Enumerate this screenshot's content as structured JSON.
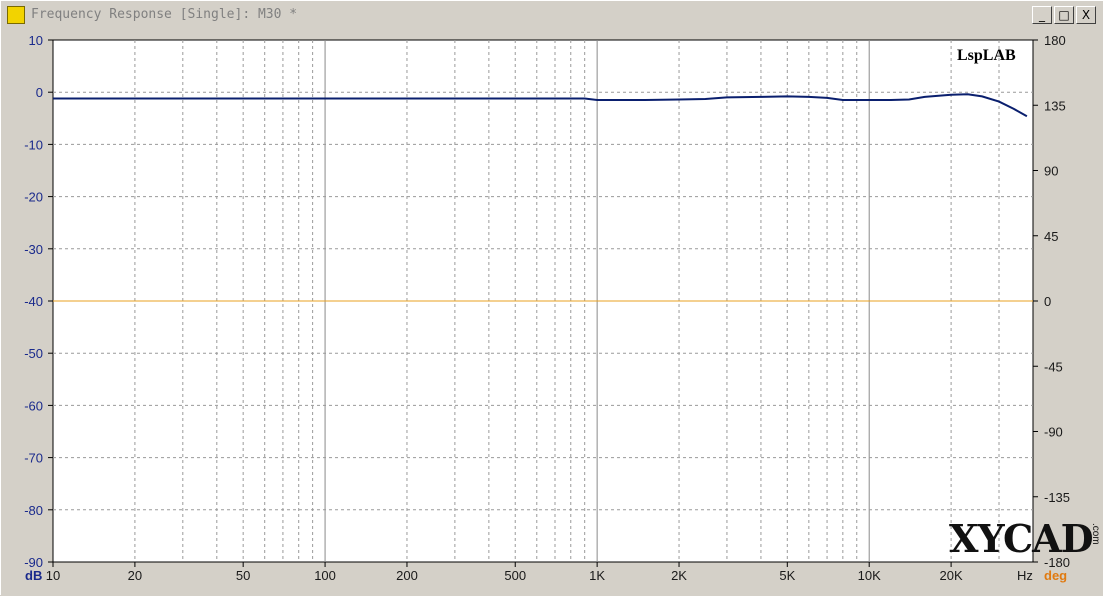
{
  "window": {
    "title": "Frequency Response [Single]: M30 *",
    "buttons": {
      "minimize": "_",
      "maximize": "□",
      "close": "X"
    }
  },
  "brand": "LspLAB",
  "watermark": {
    "text": "XYCAD",
    "suffix": ".com"
  },
  "colors": {
    "background": "#ffffff",
    "magnitude_line": "#0a1f6e",
    "phase_line": "#e8a020",
    "grid": "#9a9a9a",
    "left_axis_text": "#1a2a8c",
    "deg_label": "#e07a10"
  },
  "chart_data": {
    "type": "line",
    "x_scale": "log",
    "xlim": [
      10,
      40000
    ],
    "x_unit": "Hz",
    "x_ticks": [
      {
        "value": 10,
        "label": "10"
      },
      {
        "value": 20,
        "label": "20"
      },
      {
        "value": 50,
        "label": "50"
      },
      {
        "value": 100,
        "label": "100"
      },
      {
        "value": 200,
        "label": "200"
      },
      {
        "value": 500,
        "label": "500"
      },
      {
        "value": 1000,
        "label": "1K"
      },
      {
        "value": 2000,
        "label": "2K"
      },
      {
        "value": 5000,
        "label": "5K"
      },
      {
        "value": 10000,
        "label": "10K"
      },
      {
        "value": 20000,
        "label": "20K"
      }
    ],
    "y_left": {
      "unit": "dB",
      "ylim": [
        -90,
        10
      ],
      "ticks": [
        10,
        0,
        -10,
        -20,
        -30,
        -40,
        -50,
        -60,
        -70,
        -80,
        -90
      ]
    },
    "y_right": {
      "unit": "deg",
      "ylim": [
        -180,
        180
      ],
      "ticks": [
        180,
        135,
        90,
        45,
        0,
        -45,
        -90,
        -135,
        -180
      ]
    },
    "grid": true,
    "series": [
      {
        "axis": "left",
        "color": "#0a1f6e",
        "points": [
          [
            10,
            -1.2
          ],
          [
            20,
            -1.2
          ],
          [
            50,
            -1.2
          ],
          [
            100,
            -1.2
          ],
          [
            200,
            -1.2
          ],
          [
            500,
            -1.2
          ],
          [
            900,
            -1.2
          ],
          [
            1000,
            -1.5
          ],
          [
            1500,
            -1.5
          ],
          [
            2000,
            -1.4
          ],
          [
            2500,
            -1.3
          ],
          [
            3000,
            -1.0
          ],
          [
            4000,
            -0.9
          ],
          [
            5000,
            -0.8
          ],
          [
            6000,
            -0.9
          ],
          [
            7000,
            -1.1
          ],
          [
            8000,
            -1.5
          ],
          [
            10000,
            -1.5
          ],
          [
            12000,
            -1.5
          ],
          [
            14000,
            -1.4
          ],
          [
            16000,
            -0.9
          ],
          [
            20000,
            -0.5
          ],
          [
            23000,
            -0.4
          ],
          [
            26000,
            -0.8
          ],
          [
            30000,
            -1.8
          ],
          [
            34000,
            -3.2
          ],
          [
            38000,
            -4.6
          ]
        ]
      },
      {
        "axis": "right",
        "color": "#e8a020",
        "points": [
          [
            10,
            0
          ],
          [
            40000,
            0
          ]
        ]
      }
    ]
  }
}
